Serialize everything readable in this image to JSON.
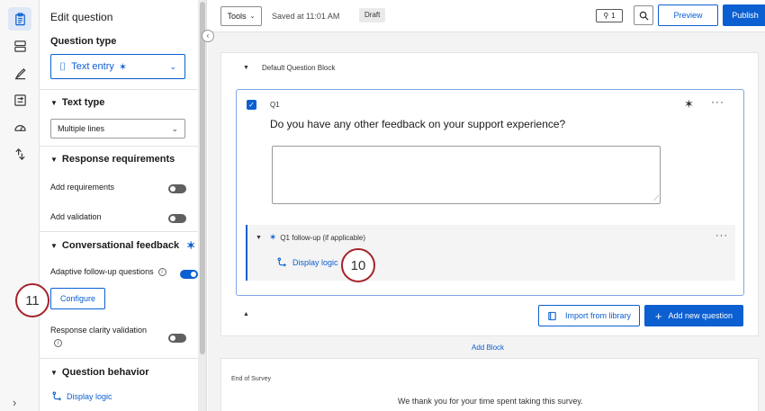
{
  "panel": {
    "title": "Edit question",
    "question_type_label": "Question type",
    "question_type_value": "Text entry",
    "text_type_heading": "Text type",
    "text_type_value": "Multiple lines",
    "response_requirements_heading": "Response requirements",
    "add_requirements_label": "Add requirements",
    "add_requirements_on": false,
    "add_validation_label": "Add validation",
    "add_validation_on": false,
    "conversational_feedback_heading": "Conversational feedback",
    "adaptive_followup_label": "Adaptive follow-up questions",
    "adaptive_followup_on": true,
    "configure_label": "Configure",
    "response_clarity_label": "Response clarity validation",
    "response_clarity_on": false,
    "question_behavior_heading": "Question behavior",
    "display_logic_label": "Display logic"
  },
  "toolbar": {
    "tools_label": "Tools",
    "saved_text": "Saved at 11:01 AM",
    "draft_badge": "Draft",
    "hint_count": "1",
    "preview_label": "Preview",
    "publish_label": "Publish"
  },
  "survey": {
    "block_name": "Default Question Block",
    "question_number": "Q1",
    "question_text": "Do you have any other feedback on your support experience?",
    "followup_label": "Q1 follow-up (if applicable)",
    "followup_display_logic": "Display logic",
    "import_label": "Import from library",
    "add_question_label": "Add new question",
    "add_block_label": "Add Block",
    "end_of_survey_label": "End of Survey",
    "end_of_survey_text": "We thank you for your time spent taking this survey."
  },
  "callouts": {
    "left_number": "11",
    "right_number": "10"
  },
  "colors": {
    "accent": "#0b5fd1",
    "callout_border": "#a3242b"
  },
  "icons": [
    "survey-icon",
    "blocks-icon",
    "look-and-feel-icon",
    "survey-flow-icon",
    "dashboard-icon",
    "translate-icon",
    "sparkle-icon",
    "search-icon",
    "lightbulb-icon",
    "display-logic-icon",
    "library-icon"
  ]
}
